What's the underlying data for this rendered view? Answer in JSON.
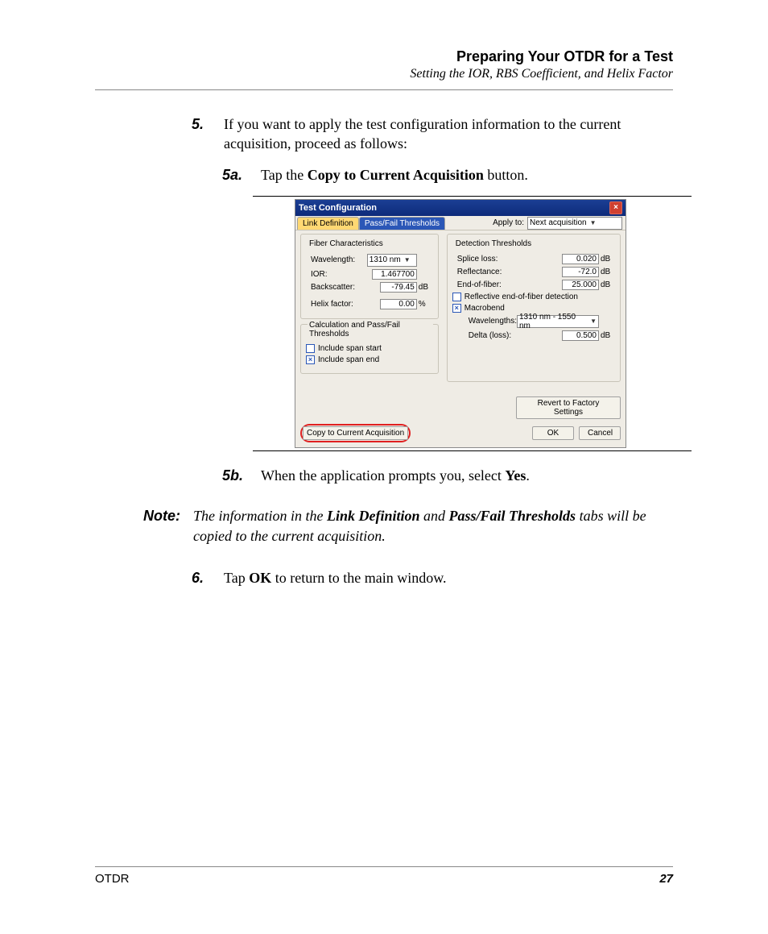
{
  "header": {
    "title": "Preparing Your OTDR for a Test",
    "subtitle": "Setting the IOR, RBS Coefficient, and Helix Factor"
  },
  "steps": {
    "s5_num": "5.",
    "s5_text_a": "If you want to apply the test configuration information to the current acquisition, proceed as follows:",
    "s5a_num": "5a.",
    "s5a_pre": "Tap the ",
    "s5a_bold": "Copy to Current Acquisition",
    "s5a_post": " button.",
    "s5b_num": "5b.",
    "s5b_pre": "When the application prompts you, select ",
    "s5b_bold": "Yes",
    "s5b_post": ".",
    "s6_num": "6.",
    "s6_pre": "Tap ",
    "s6_bold": "OK",
    "s6_post": " to return to the main window."
  },
  "note": {
    "label": "Note:",
    "pre": "The information in the ",
    "b1": "Link Definition",
    "mid": " and ",
    "b2": "Pass/Fail Thresholds",
    "post": " tabs will be copied to the current acquisition."
  },
  "dialog": {
    "title": "Test Configuration",
    "tabs": {
      "active": "Link Definition",
      "inactive": "Pass/Fail Thresholds"
    },
    "apply_to_label": "Apply to:",
    "apply_to_value": "Next acquisition",
    "left_group1_title": "Fiber Characteristics",
    "left_group2_title": "Calculation and Pass/Fail Thresholds",
    "right_group_title": "Detection Thresholds",
    "wavelength_label": "Wavelength:",
    "wavelength_value": "1310 nm",
    "ior_label": "IOR:",
    "ior_value": "1.467700",
    "backscatter_label": "Backscatter:",
    "backscatter_value": "-79.45",
    "backscatter_unit": "dB",
    "helix_label": "Helix factor:",
    "helix_value": "0.00",
    "helix_unit": "%",
    "include_start": "Include span start",
    "include_end": "Include span end",
    "splice_label": "Splice loss:",
    "splice_value": "0.020",
    "splice_unit": "dB",
    "refl_label": "Reflectance:",
    "refl_value": "-72.0",
    "refl_unit": "dB",
    "eof_label": "End-of-fiber:",
    "eof_value": "25.000",
    "eof_unit": "dB",
    "reflective_eof": "Reflective end-of-fiber detection",
    "macrobend": "Macrobend",
    "mb_wavelengths_label": "Wavelengths:",
    "mb_wavelengths_value": "1310 nm - 1550 nm",
    "mb_delta_label": "Delta (loss):",
    "mb_delta_value": "0.500",
    "mb_delta_unit": "dB",
    "revert_btn": "Revert to Factory Settings",
    "copy_btn": "Copy to Current Acquisition",
    "ok_btn": "OK",
    "cancel_btn": "Cancel"
  },
  "footer": {
    "left": "OTDR",
    "right": "27"
  }
}
